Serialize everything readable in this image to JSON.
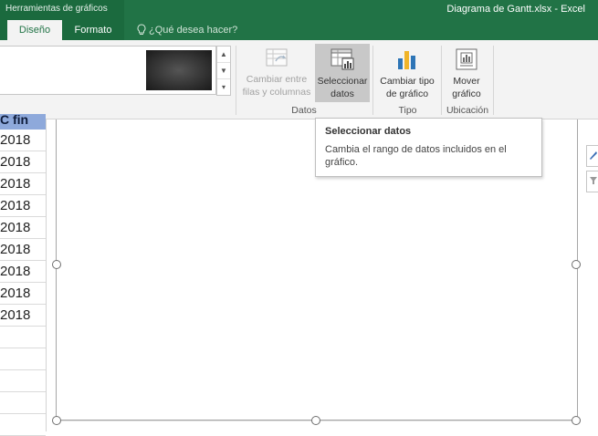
{
  "window": {
    "context_tab_group": "Herramientas de gráficos",
    "title": "Diagrama de Gantt.xlsx - Excel"
  },
  "tabs": [
    {
      "label": "Diseño",
      "active": true
    },
    {
      "label": "Formato",
      "active": false
    }
  ],
  "tell_me": {
    "label": "¿Qué desea hacer?",
    "icon": "lightbulb-icon"
  },
  "ribbon": {
    "buttons": {
      "switch_row_column": {
        "line1": "Cambiar entre",
        "line2": "filas y columnas",
        "icon": "switch-row-column-icon",
        "enabled": false
      },
      "select_data": {
        "line1": "Seleccionar",
        "line2": "datos",
        "icon": "select-data-icon",
        "highlighted": true
      },
      "change_chart_type": {
        "line1": "Cambiar tipo",
        "line2": "de gráfico",
        "icon": "change-chart-type-icon"
      },
      "move_chart": {
        "line1": "Mover",
        "line2": "gráfico",
        "icon": "move-chart-icon"
      }
    },
    "groups": {
      "data": "Datos",
      "type": "Tipo",
      "location": "Ubicación"
    }
  },
  "tooltip": {
    "title": "Seleccionar datos",
    "body": "Cambia el rango de datos incluidos en el gráfico."
  },
  "cells": {
    "header": "C fin",
    "rows": [
      "2018",
      "2018",
      "2018",
      "2018",
      "2018",
      "2018",
      "2018",
      "2018",
      "2018"
    ]
  },
  "colors": {
    "excel_green": "#217346",
    "header_fill": "#8ea9db",
    "ribbon_bg": "#f3f3f3"
  }
}
